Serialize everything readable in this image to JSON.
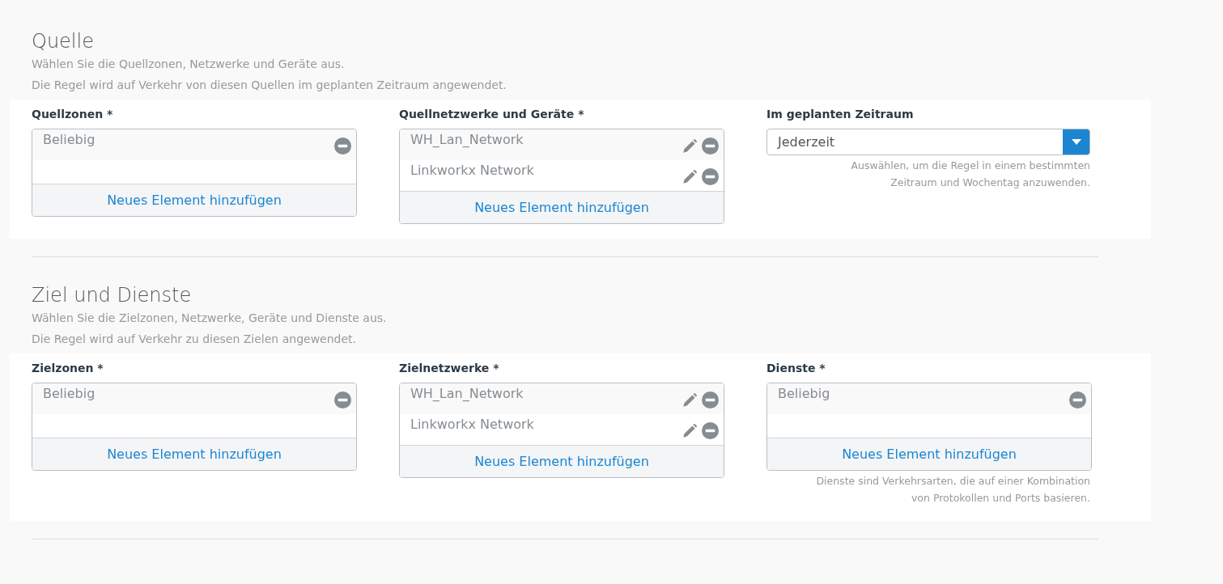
{
  "sections": [
    {
      "title": "Quelle",
      "description": [
        "Wählen Sie die Quellzonen, Netzwerke und Geräte aus.",
        "Die Regel wird auf Verkehr von diesen Quellen im geplanten Zeitraum angewendet."
      ],
      "fields": [
        {
          "kind": "list",
          "label": "Quellzonen *",
          "items": [
            {
              "text": "Beliebig",
              "editable": false
            }
          ],
          "add_link": "Neues Element hinzufügen"
        },
        {
          "kind": "list",
          "label": "Quellnetzwerke und Geräte *",
          "items": [
            {
              "text": "WH_Lan_Network",
              "editable": true
            },
            {
              "text": "Linkworkx Network",
              "editable": true
            }
          ],
          "add_link": "Neues Element hinzufügen"
        },
        {
          "kind": "select",
          "label": "Im geplanten Zeitraum",
          "value": "Jederzeit",
          "hint": [
            "Auswählen, um die Regel in einem bestimmten",
            "Zeitraum und Wochentag anzuwenden."
          ]
        }
      ]
    },
    {
      "title": "Ziel und Dienste",
      "description": [
        "Wählen Sie die Zielzonen, Netzwerke, Geräte und Dienste aus.",
        "Die Regel wird auf Verkehr zu diesen Zielen angewendet."
      ],
      "fields": [
        {
          "kind": "list",
          "label": "Zielzonen *",
          "items": [
            {
              "text": "Beliebig",
              "editable": false
            }
          ],
          "add_link": "Neues Element hinzufügen"
        },
        {
          "kind": "list",
          "label": "Zielnetzwerke *",
          "items": [
            {
              "text": "WH_Lan_Network",
              "editable": true
            },
            {
              "text": "Linkworkx Network",
              "editable": true
            }
          ],
          "add_link": "Neues Element hinzufügen"
        },
        {
          "kind": "list",
          "label": "Dienste *",
          "items": [
            {
              "text": "Beliebig",
              "editable": false
            }
          ],
          "add_link": "Neues Element hinzufügen",
          "hint": [
            "Dienste sind Verkehrsarten, die auf einer Kombination",
            "von Protokollen und Ports basieren."
          ]
        }
      ]
    }
  ]
}
